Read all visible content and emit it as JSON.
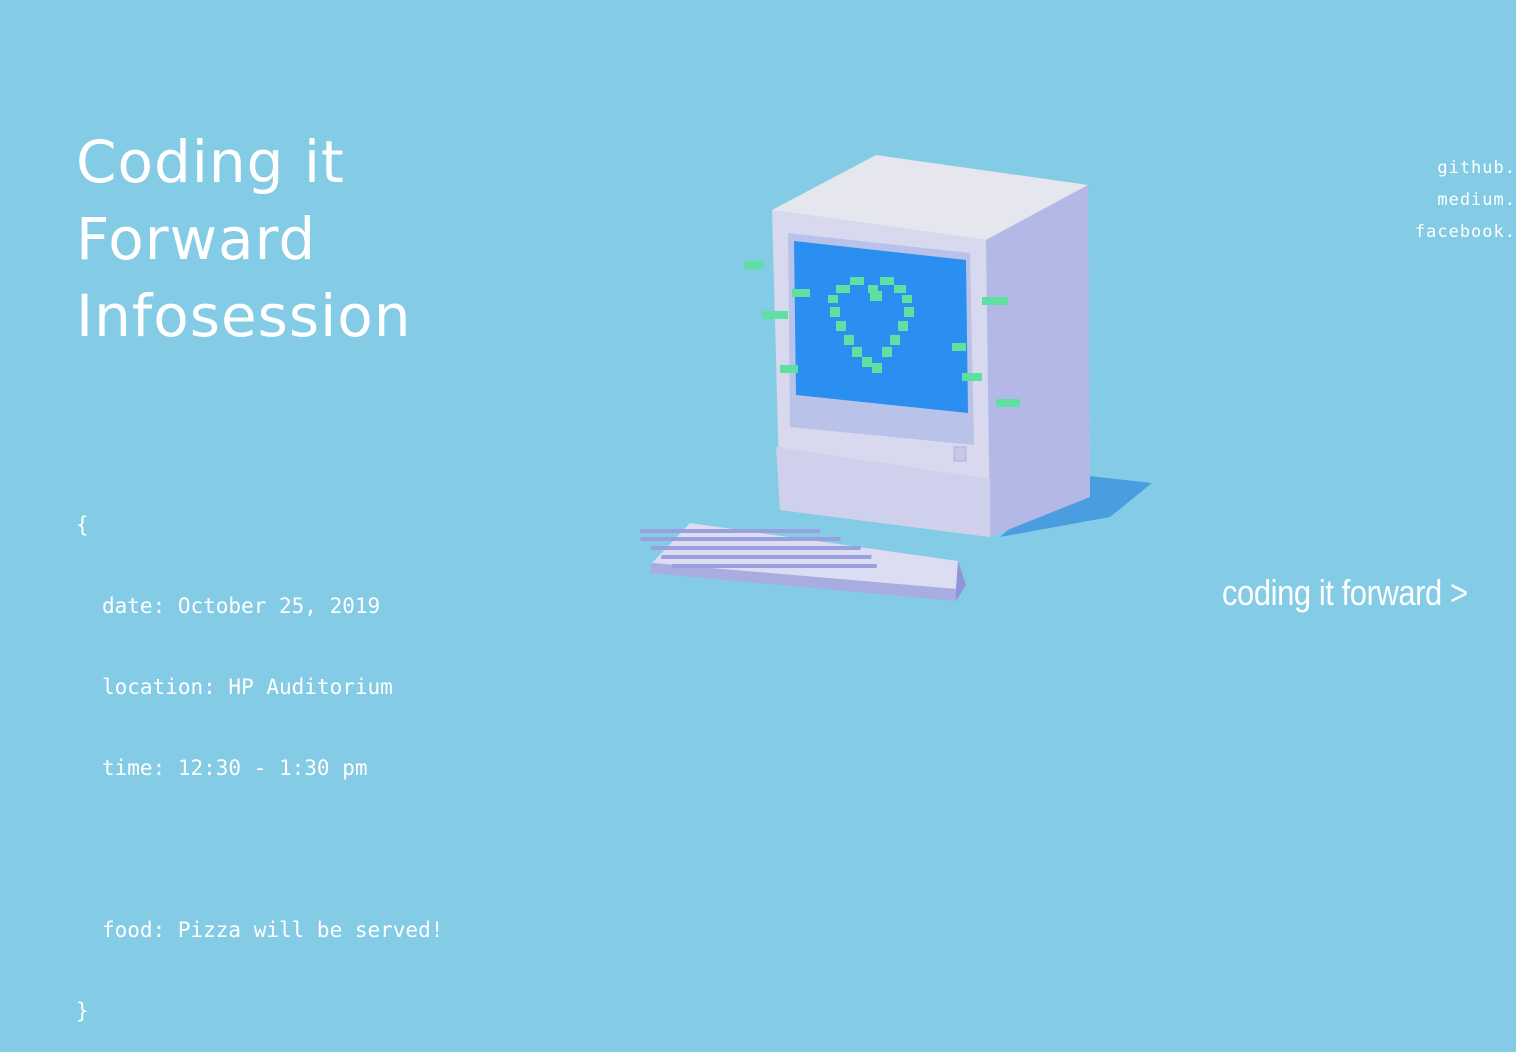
{
  "hero": {
    "title_lines": [
      "Coding it",
      "Forward",
      "Infosession"
    ]
  },
  "event": {
    "open_brace": "{",
    "date": "date: October 25, 2019",
    "location": "location: HP Auditorium",
    "time": "time: 12:30 - 1:30 pm",
    "food": "food: Pizza will be served!",
    "close_brace": "}"
  },
  "social_links": [
    "github.",
    "medium.",
    "facebook."
  ],
  "cta": {
    "label": "coding it forward >"
  },
  "illustration": {
    "name": "retro-computer-heart",
    "colors": {
      "body": "#dcdcf0",
      "screen": "#2a8ff0",
      "heart": "#5fe0a0",
      "shadow": "#3f97dc"
    }
  }
}
